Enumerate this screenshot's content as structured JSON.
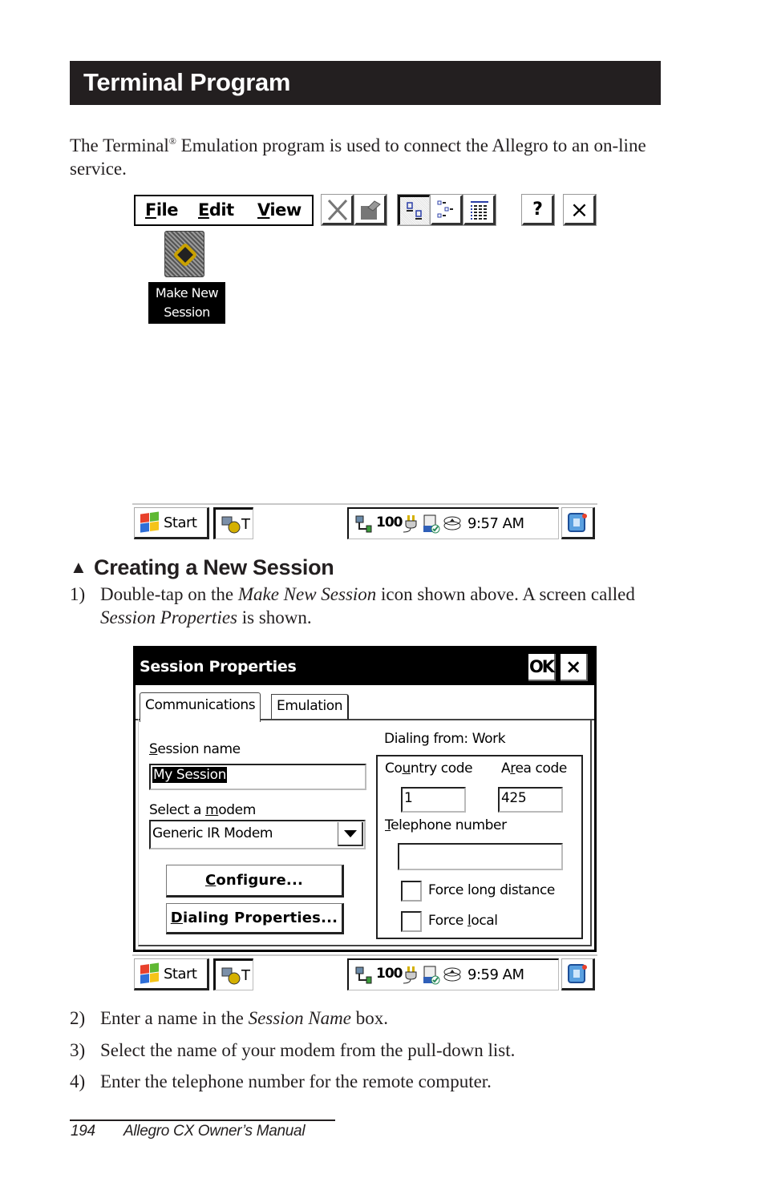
{
  "page": {
    "section_title": "Terminal Program",
    "intro_part1": "The Terminal",
    "intro_reg": "®",
    "intro_part2": " Emulation program is used to connect the Allegro to an on-line service.",
    "subheading": "Creating a New Session",
    "subheading_icon": "triangle-up-icon",
    "steps": [
      {
        "num": "1)",
        "parts": [
          "Double-tap on the ",
          "Make New Session",
          " icon shown above. A screen called ",
          "Session Properties",
          " is shown."
        ]
      },
      {
        "num": "2)",
        "parts": [
          "Enter a name in the ",
          "Session Name",
          " box."
        ]
      },
      {
        "num": "3)",
        "parts": [
          "Select the name of your modem from the pull-down list."
        ]
      },
      {
        "num": "4)",
        "parts": [
          "Enter the telephone number for the remote computer."
        ]
      }
    ],
    "footer": {
      "page_number": "194",
      "manual_title": "Allegro CX Owner’s Manual"
    }
  },
  "screen1": {
    "menu": [
      {
        "label": "File",
        "accel": "F",
        "rest": "ile"
      },
      {
        "label": "Edit",
        "accel": "E",
        "rest": "dit"
      },
      {
        "label": "View",
        "accel": "V",
        "rest": "iew"
      }
    ],
    "toolbar_icons": [
      "delete-icon",
      "properties-icon",
      "large-icons-view-icon",
      "small-icons-view-icon",
      "details-view-icon",
      "help-icon",
      "close-icon"
    ],
    "help_label": "?",
    "close_label": "×",
    "desktop_icon": {
      "icon": "make-new-session-icon",
      "label_line1": "Make New",
      "label_line2": "Session"
    },
    "taskbar": {
      "start_label": "Start",
      "task_label": "T",
      "tray_badge": "100",
      "clock": "9:57 AM"
    }
  },
  "screen2": {
    "dialog_title": "Session Properties",
    "ok_label": "OK",
    "close_label": "×",
    "tabs": [
      {
        "label": "Communications",
        "active": true
      },
      {
        "label": "Emulation",
        "active": false
      }
    ],
    "session_name": {
      "label_accel": "S",
      "label_rest": "ession name",
      "value": "My Session"
    },
    "modem": {
      "label_pre": "Select a ",
      "label_accel": "m",
      "label_rest": "odem",
      "value": "Generic IR Modem"
    },
    "configure_button": {
      "accel": "C",
      "rest": "onfigure..."
    },
    "dialing_button": {
      "accel": "D",
      "rest": "ialing Properties..."
    },
    "dialing_from": "Dialing from: Work",
    "country_code": {
      "label_pre": "Co",
      "label_accel": "u",
      "label_rest": "ntry code",
      "value": "1"
    },
    "area_code": {
      "label_pre": "A",
      "label_accel": "r",
      "label_rest": "ea code",
      "value": "425"
    },
    "telephone": {
      "label_accel": "T",
      "label_rest": "elephone number",
      "value": ""
    },
    "force_long_distance": {
      "label_pre": "Force lon",
      "label_accel": "g",
      "label_rest": " distance",
      "checked": false
    },
    "force_local": {
      "label_pre": "Force ",
      "label_accel": "l",
      "label_rest": "ocal",
      "checked": false
    },
    "taskbar": {
      "start_label": "Start",
      "task_label": "T",
      "tray_badge": "100",
      "clock": "9:59 AM"
    }
  },
  "colors": {
    "title_bar": "#231f20",
    "text": "#231f20",
    "selection": "#000000",
    "windows_flag": [
      "#e8412c",
      "#5fb832",
      "#2f6fd8",
      "#f5c419"
    ]
  }
}
